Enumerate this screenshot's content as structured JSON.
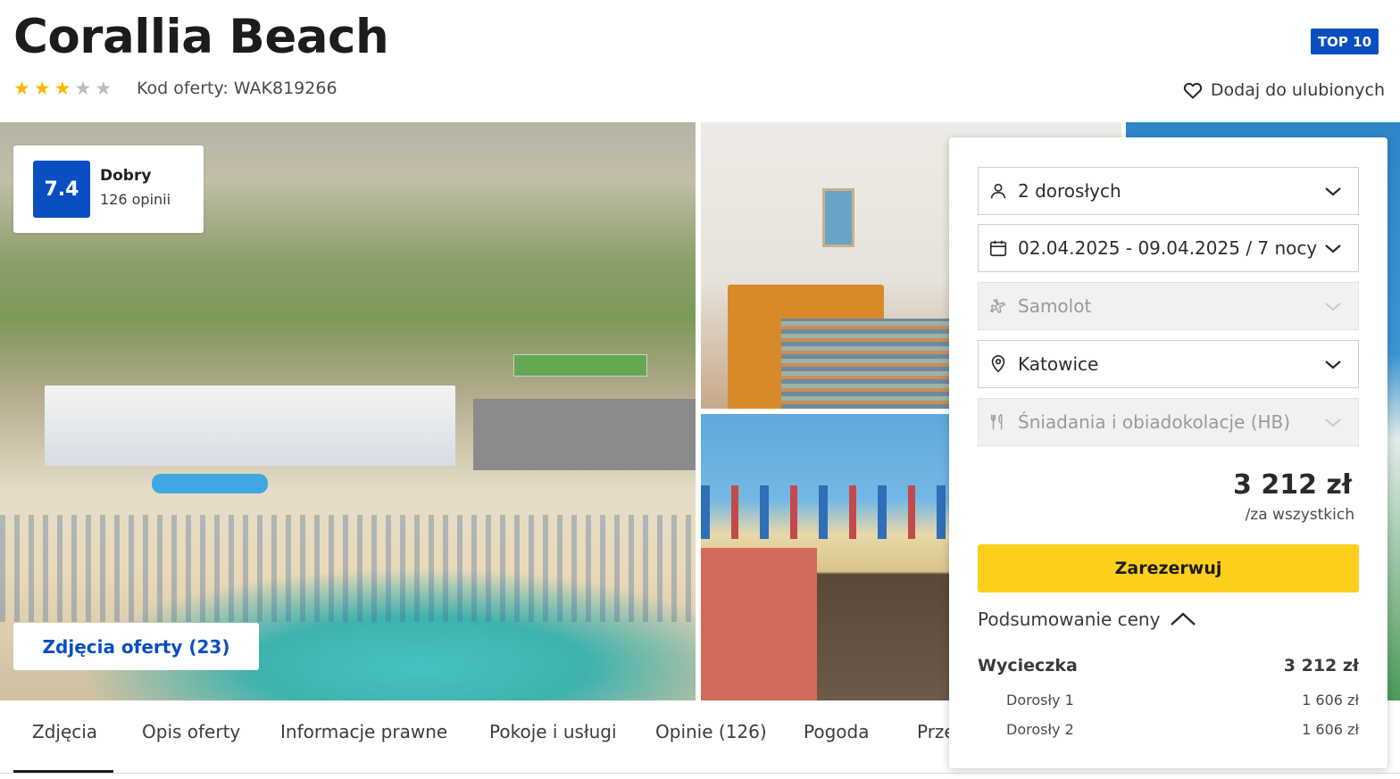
{
  "header": {
    "title": "Corallia Beach",
    "badge": "TOP 10",
    "stars_filled": 3,
    "stars_total": 5,
    "offer_code": "Kod oferty: WAK819266",
    "favorite_label": "Dodaj do ulubionych"
  },
  "rating": {
    "score": "7.4",
    "label": "Dobry",
    "count": "126 opinii"
  },
  "gallery": {
    "photos_button": "Zdjęcia oferty (23)"
  },
  "tabs": [
    {
      "label": "Zdjęcia",
      "active": true
    },
    {
      "label": "Opis oferty"
    },
    {
      "label": "Informacje prawne"
    },
    {
      "label": "Pokoje i usługi"
    },
    {
      "label": "Opinie (126)"
    },
    {
      "label": "Pogoda"
    },
    {
      "label": "Prze"
    }
  ],
  "booking": {
    "travelers": "2 dorosłych",
    "dates": "02.04.2025 - 09.04.2025 / 7 nocy",
    "transport": "Samolot",
    "departure": "Katowice",
    "board": "Śniadania i obiadokolacje (HB)",
    "price": "3 212 zł",
    "price_note": "/za wszystkich",
    "book_label": "Zarezerwuj",
    "summary_label": "Podsumowanie ceny",
    "summary": {
      "trip_label": "Wycieczka",
      "trip_total": "3 212 zł",
      "rows": [
        {
          "label": "Dorosły 1",
          "value": "1 606 zł"
        },
        {
          "label": "Dorosły 2",
          "value": "1 606 zł"
        }
      ]
    }
  },
  "colors": {
    "brand_blue": "#0a4fc2",
    "cta_yellow": "#fdcf1c",
    "star_gold": "#f5b800"
  }
}
